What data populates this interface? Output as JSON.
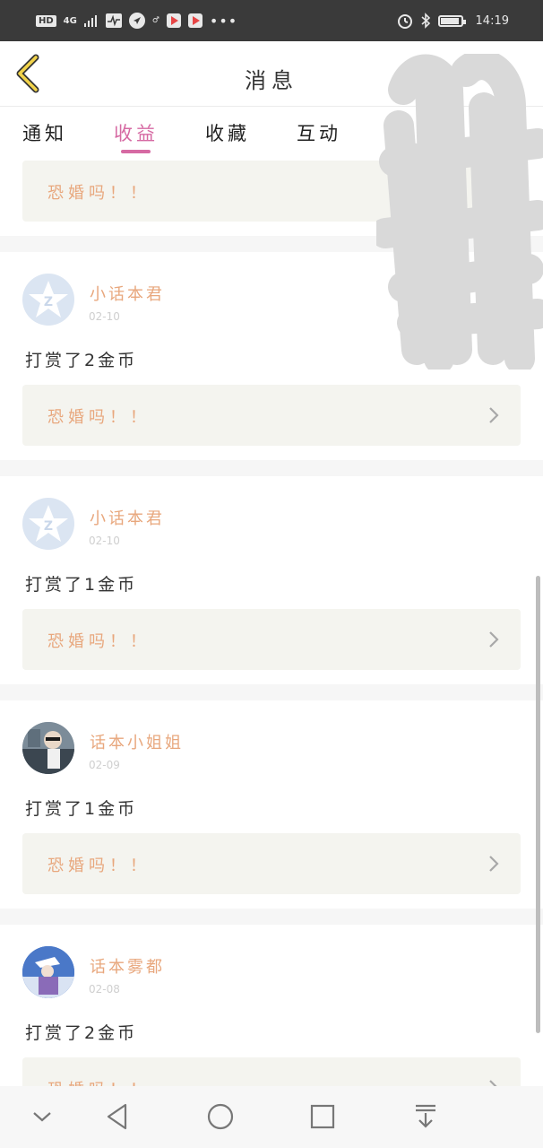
{
  "status_bar": {
    "network_badge": "HD",
    "network_type": "4G",
    "time": "14:19",
    "icons": [
      "signal-icon",
      "activity-icon",
      "navigation-icon",
      "app-icon",
      "app-icon",
      "more-icon",
      "alarm-icon",
      "bluetooth-icon",
      "battery-icon"
    ]
  },
  "header": {
    "title": "消息",
    "back_icon": "chevron-left-icon",
    "expand_icon": "expand-icon"
  },
  "tabs": [
    {
      "label": "通知",
      "active": false
    },
    {
      "label": "收益",
      "active": true
    },
    {
      "label": "收藏",
      "active": false
    },
    {
      "label": "互动",
      "active": false
    }
  ],
  "partial_card": {
    "quote": "恐婚吗！！"
  },
  "cards": [
    {
      "user": "小话本君",
      "date": "02-10",
      "message": "打赏了2金币",
      "quote": "恐婚吗！！",
      "avatar": "default-avatar"
    },
    {
      "user": "小话本君",
      "date": "02-10",
      "message": "打赏了1金币",
      "quote": "恐婚吗！！",
      "avatar": "default-avatar"
    },
    {
      "user": "话本小姐姐",
      "date": "02-09",
      "message": "打赏了1金币",
      "quote": "恐婚吗！！",
      "avatar": "photo-avatar"
    },
    {
      "user": "话本雾都",
      "date": "02-08",
      "message": "打赏了2金币",
      "quote": "恐婚吗！！",
      "avatar": "photo-avatar"
    }
  ],
  "colors": {
    "accent": "#d66aa3",
    "username": "#e8a77d",
    "quote_bg": "#f4f4ef",
    "status_bar": "#3a3a3a"
  },
  "nav_bar": [
    "chevron-down-icon",
    "back-triangle-icon",
    "home-circle-icon",
    "recents-square-icon",
    "download-icon"
  ]
}
